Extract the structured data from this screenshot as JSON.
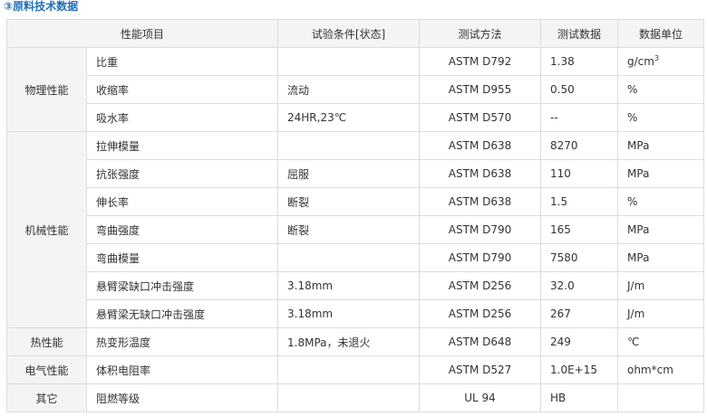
{
  "heading": "③原料技术数据",
  "headers": {
    "property": "性能项目",
    "condition": "试验条件[状态]",
    "method": "测试方法",
    "value": "测试数据",
    "unit": "数据单位"
  },
  "groups": [
    {
      "name": "物理性能",
      "rows": [
        {
          "item": "比重",
          "condition": "",
          "method": "ASTM D792",
          "value": "1.38",
          "unit": "g/cm",
          "unit_sup": "3"
        },
        {
          "item": "收缩率",
          "condition": "流动",
          "method": "ASTM D955",
          "value": "0.50",
          "unit": "%"
        },
        {
          "item": "吸水率",
          "condition": "24HR,23℃",
          "method": "ASTM D570",
          "value": "--",
          "unit": "%"
        }
      ]
    },
    {
      "name": "机械性能",
      "rows": [
        {
          "item": "拉伸模量",
          "condition": "",
          "method": "ASTM D638",
          "value": "8270",
          "unit": "MPa"
        },
        {
          "item": "抗张强度",
          "condition": "屈服",
          "method": "ASTM D638",
          "value": "110",
          "unit": "MPa"
        },
        {
          "item": "伸长率",
          "condition": "断裂",
          "method": "ASTM D638",
          "value": "1.5",
          "unit": "%"
        },
        {
          "item": "弯曲强度",
          "condition": "断裂",
          "method": "ASTM D790",
          "value": "165",
          "unit": "MPa"
        },
        {
          "item": "弯曲模量",
          "condition": "",
          "method": "ASTM D790",
          "value": "7580",
          "unit": "MPa"
        },
        {
          "item": "悬臂梁缺口冲击强度",
          "condition": "3.18mm",
          "method": "ASTM D256",
          "value": "32.0",
          "unit": "J/m"
        },
        {
          "item": "悬臂梁无缺口冲击强度",
          "condition": "3.18mm",
          "method": "ASTM D256",
          "value": "267",
          "unit": "J/m"
        }
      ]
    },
    {
      "name": "热性能",
      "rows": [
        {
          "item": "热变形温度",
          "condition": "1.8MPa，未退火",
          "method": "ASTM D648",
          "value": "249",
          "unit": "℃"
        }
      ]
    },
    {
      "name": "电气性能",
      "rows": [
        {
          "item": "体积电阻率",
          "condition": "",
          "method": "ASTM D527",
          "value": "1.0E+15",
          "unit": "ohm*cm"
        }
      ]
    },
    {
      "name": "其它",
      "rows": [
        {
          "item": "阻燃等级",
          "condition": "",
          "method": "UL 94",
          "value": "HB",
          "unit": ""
        }
      ]
    }
  ]
}
